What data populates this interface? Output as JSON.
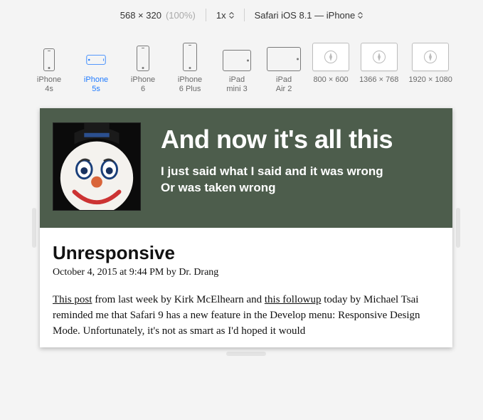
{
  "toolbar": {
    "dimensions": "568 × 320",
    "zoom_percent": "(100%)",
    "scale": "1x",
    "user_agent": "Safari iOS 8.1 — iPhone"
  },
  "devices": [
    {
      "key": "iphone4s",
      "line1": "iPhone",
      "line2": "4s"
    },
    {
      "key": "iphone5s",
      "line1": "iPhone",
      "line2": "5s"
    },
    {
      "key": "iphone6",
      "line1": "iPhone",
      "line2": "6"
    },
    {
      "key": "iphone6plus",
      "line1": "iPhone",
      "line2": "6 Plus"
    },
    {
      "key": "ipadmini3",
      "line1": "iPad",
      "line2": "mini 3"
    },
    {
      "key": "ipadair2",
      "line1": "iPad",
      "line2": "Air 2"
    },
    {
      "key": "800x600",
      "label": "800 × 600"
    },
    {
      "key": "1366x768",
      "label": "1366 × 768"
    },
    {
      "key": "1920x1080",
      "label": "1920 × 1080"
    }
  ],
  "page": {
    "site_title": "And now it's all this",
    "tagline_l1": "I just said what I said and it was wrong",
    "tagline_l2": "Or was taken wrong",
    "post_title": "Unresponsive",
    "meta": "October 4, 2015 at 9:44 PM by Dr. Drang",
    "body_link1": "This post",
    "body_seg1": " from last week by Kirk McElhearn and ",
    "body_link2": "this followup",
    "body_seg2": " today by Michael Tsai reminded me that Safari 9 has a new feature in the Develop menu: Responsive Design Mode. Unfortunately, it's not as smart as I'd hoped it would"
  }
}
